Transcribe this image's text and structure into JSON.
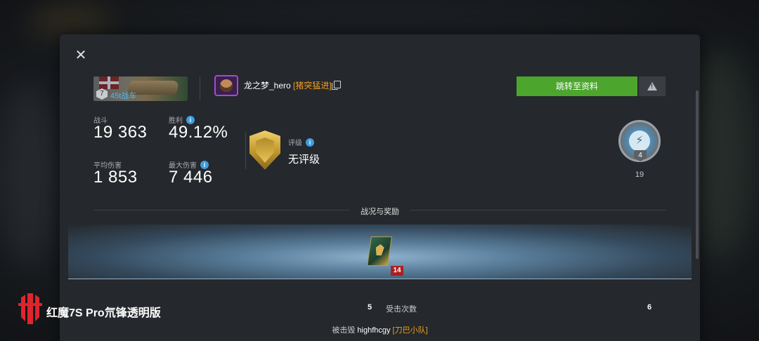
{
  "dialog": {
    "close_label": "✕"
  },
  "tank": {
    "tier": "7",
    "name": "45t战车"
  },
  "player": {
    "name": "龙之梦_hero",
    "clan": "[猪突猛进]"
  },
  "actions": {
    "profile_button": "跳转至资料",
    "report_icon": "warning-icon"
  },
  "stats": {
    "battles_label": "战斗",
    "battles_value": "19 363",
    "wins_label": "胜利",
    "wins_value": "49.12%",
    "avg_damage_label": "平均伤害",
    "avg_damage_value": "1 853",
    "max_damage_label": "最大伤害",
    "max_damage_value": "7 446"
  },
  "rating": {
    "label": "评级",
    "value": "无评级"
  },
  "mastery": {
    "level": "4",
    "count": "19"
  },
  "section": {
    "title": "战况与奖励"
  },
  "medal": {
    "count": "14"
  },
  "battle_row": {
    "left_value": "5",
    "label": "受击次数",
    "right_value": "6"
  },
  "destroyed": {
    "prefix": "被击毁",
    "killer": "highfhcgy",
    "killer_clan": "[刀巴小队]"
  },
  "watermark": {
    "text": "红魔7S Pro氘锋透明版"
  },
  "colors": {
    "accent_green": "#4ca62e",
    "clan_orange": "#f0a020",
    "info_blue": "#3e9de0",
    "tank_name_blue": "#4fb8f0"
  }
}
